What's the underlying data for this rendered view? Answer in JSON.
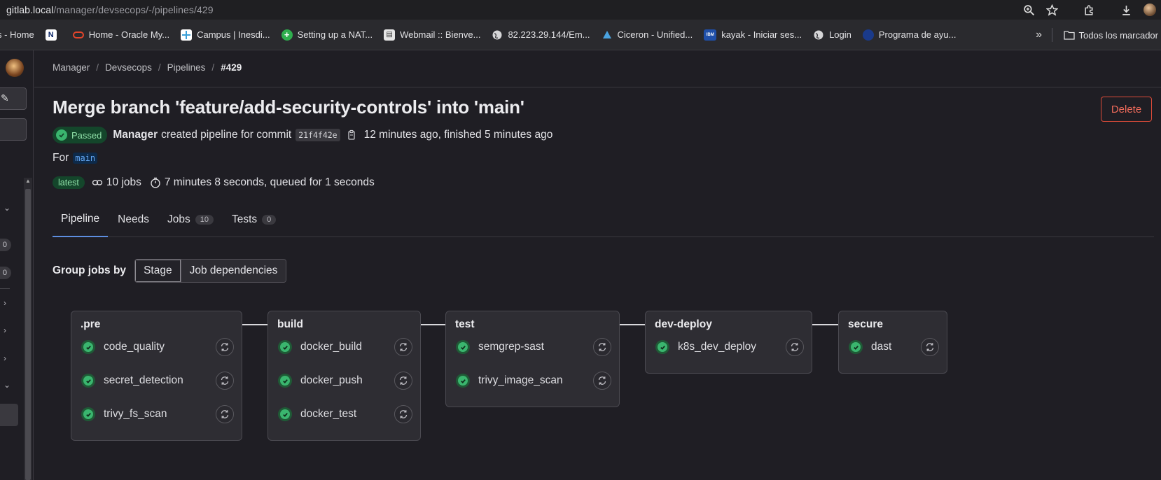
{
  "browser": {
    "url_host": "gitlab.local",
    "url_path": "/manager/devsecops/-/pipelines/429",
    "bookmarks": [
      {
        "label": "s - Home",
        "icon": "none"
      },
      {
        "label": "",
        "icon": "logo-n-icon"
      },
      {
        "label": "Home - Oracle My...",
        "icon": "oracle-icon"
      },
      {
        "label": "Campus | Inesdi...",
        "icon": "campus-icon"
      },
      {
        "label": "Setting up a NAT...",
        "icon": "plus-icon"
      },
      {
        "label": "Webmail :: Bienve...",
        "icon": "webmail-icon"
      },
      {
        "label": "82.223.29.144/Em...",
        "icon": "globe-icon"
      },
      {
        "label": "Ciceron - Unified...",
        "icon": "ciceron-icon"
      },
      {
        "label": "kayak - Iniciar ses...",
        "icon": "ibm-icon"
      },
      {
        "label": "Login",
        "icon": "globe-icon"
      },
      {
        "label": "Programa de ayu...",
        "icon": "circle-icon"
      }
    ],
    "bookmarks_more": "»",
    "bookmarks_folder": "Todos los marcador"
  },
  "sidebar": {
    "counts": [
      "0",
      "0"
    ]
  },
  "breadcrumb": {
    "items": [
      "Manager",
      "Devsecops",
      "Pipelines"
    ],
    "current": "#429"
  },
  "header": {
    "title": "Merge branch 'feature/add-security-controls' into 'main'",
    "delete_label": "Delete",
    "status_label": "Passed",
    "author": "Manager",
    "created_text": "created pipeline for commit",
    "commit_sha": "21f4f42e",
    "time_text": "12 minutes ago, finished 5 minutes ago",
    "for_label": "For",
    "branch": "main",
    "latest_label": "latest",
    "jobs_text": "10 jobs",
    "duration_text": "7 minutes 8 seconds, queued for 1 seconds"
  },
  "tabs": [
    {
      "label": "Pipeline",
      "count": null
    },
    {
      "label": "Needs",
      "count": null
    },
    {
      "label": "Jobs",
      "count": "10"
    },
    {
      "label": "Tests",
      "count": "0"
    }
  ],
  "grouping": {
    "label": "Group jobs by",
    "options": [
      "Stage",
      "Job dependencies"
    ],
    "selected": "Stage"
  },
  "stages": [
    {
      "name": ".pre",
      "jobs": [
        "code_quality",
        "secret_detection",
        "trivy_fs_scan"
      ]
    },
    {
      "name": "build",
      "jobs": [
        "docker_build",
        "docker_push",
        "docker_test"
      ]
    },
    {
      "name": "test",
      "jobs": [
        "semgrep-sast",
        "trivy_image_scan"
      ]
    },
    {
      "name": "dev-deploy",
      "jobs": [
        "k8s_dev_deploy"
      ]
    },
    {
      "name": "secure",
      "jobs": [
        "dast"
      ]
    }
  ],
  "colors": {
    "success": "#3ab56e",
    "danger": "#dd4b39",
    "link": "#63a6f3"
  }
}
